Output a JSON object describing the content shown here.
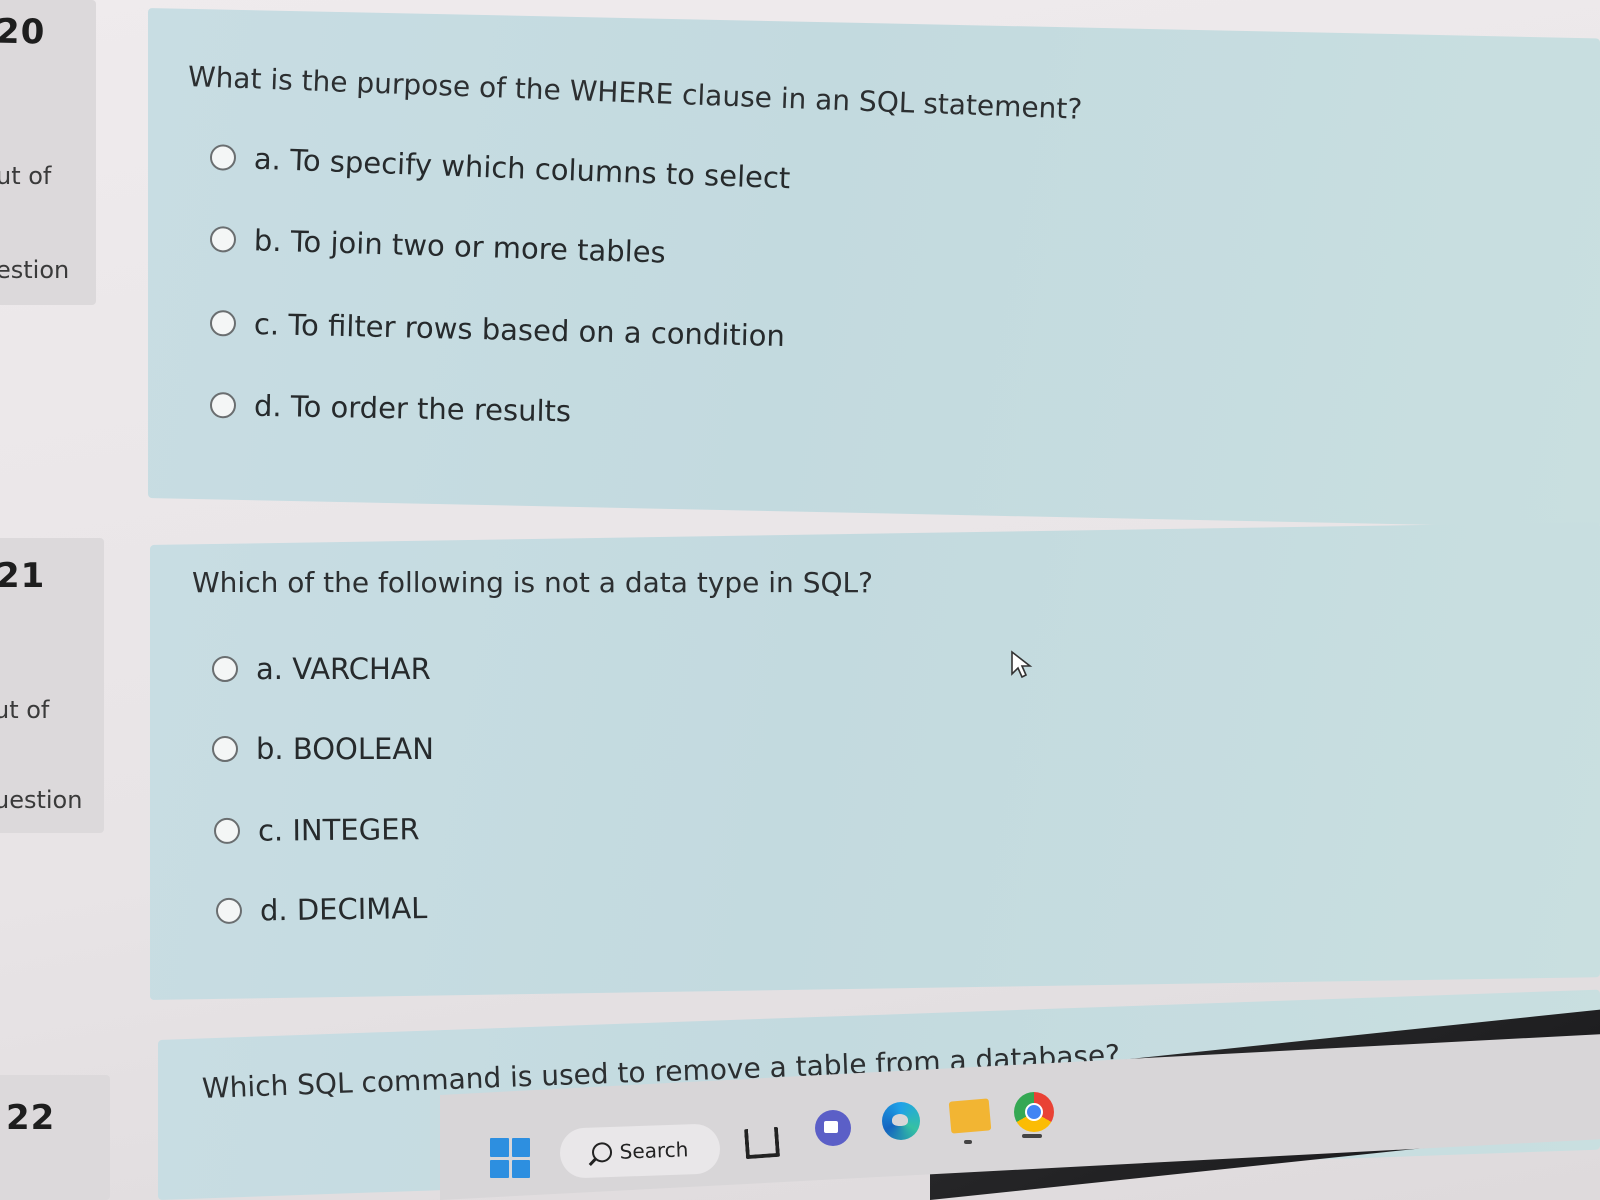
{
  "questions": [
    {
      "number": "20",
      "meta_top": "ut of",
      "meta_bottom": "estion",
      "text": "What is the purpose of the WHERE clause in an SQL statement?",
      "options": [
        "a. To specify which columns to select",
        "b. To join two or more tables",
        "c. To filter rows based on a condition",
        "d. To order the results"
      ]
    },
    {
      "number": "21",
      "meta_top": "ut of",
      "meta_bottom": "uestion",
      "text": "Which of the following is not a data type in SQL?",
      "options": [
        "a. VARCHAR",
        "b. BOOLEAN",
        "c. INTEGER",
        "d. DECIMAL"
      ]
    },
    {
      "number": "22",
      "text": "Which SQL command is used to remove a table from a database?"
    }
  ],
  "taskbar": {
    "search_label": "Search",
    "icons": [
      "windows-start-icon",
      "search-icon",
      "file-explorer-icon",
      "teams-chat-icon",
      "edge-icon",
      "folder-icon",
      "chrome-icon"
    ]
  },
  "colors": {
    "card_bg": "#c6dce1",
    "sidebar_bg": "#dcd9db",
    "page_bg": "#ece9ea",
    "taskbar_dark": "#1a1a1c"
  }
}
